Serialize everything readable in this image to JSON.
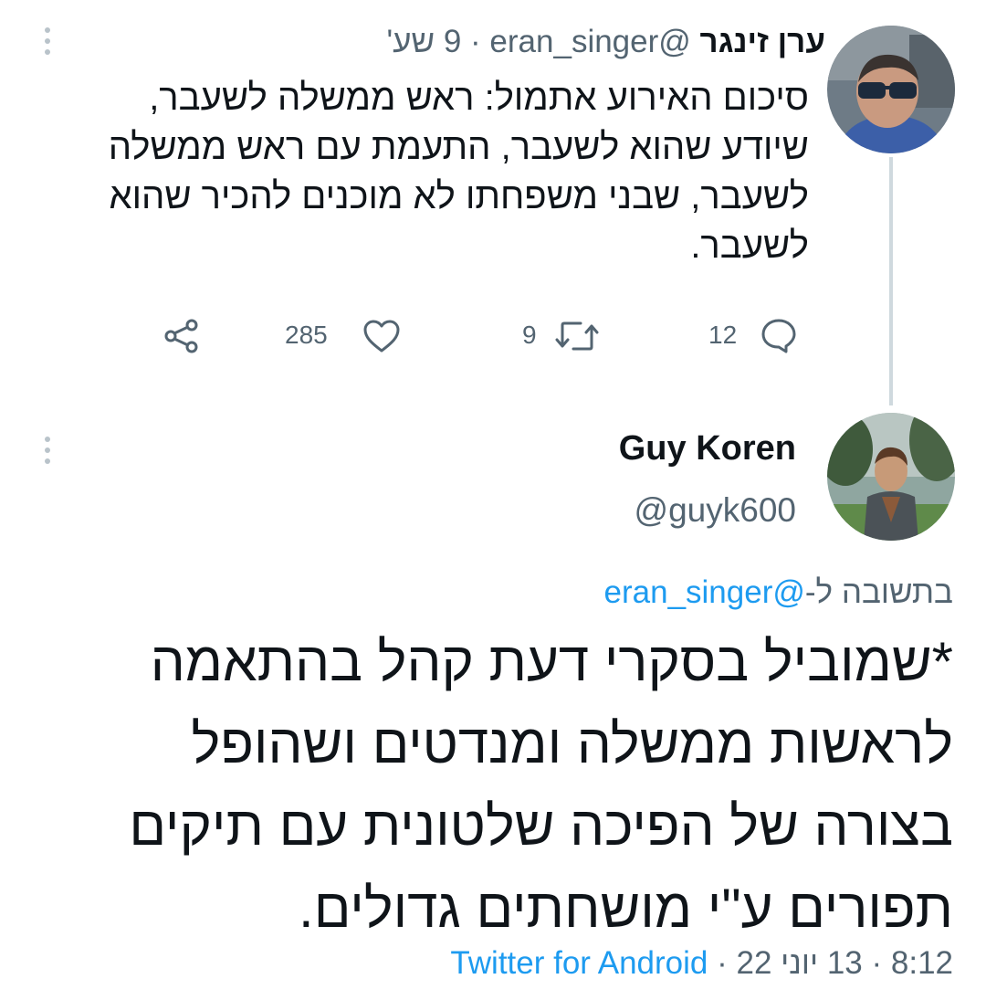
{
  "original_tweet": {
    "author_name": "ערן זינגר",
    "handle": "@eran_singer",
    "separator": "·",
    "time_ago": "9 שע'",
    "text": "סיכום האירוע אתמול: ראש ממשלה לשעבר, שיודע שהוא לשעבר, התעמת עם ראש ממשלה לשעבר, שבני משפחתו לא מוכנים להכיר שהוא לשעבר.",
    "actions": {
      "reply_count": "12",
      "retweet_count": "9",
      "like_count": "285"
    }
  },
  "reply_tweet": {
    "author_name": "Guy Koren",
    "handle": "@guyk600",
    "replying_to_label": "בתשובה ל-",
    "replying_to_handle": "@eran_singer",
    "text": "*שמוביל בסקרי דעת קהל בהתאמה לראשות ממשלה ומנדטים ושהופל בצורה של הפיכה שלטונית עם תיקים תפורים ע\"י מושחתים גדולים.",
    "time": "8:12",
    "date": "13 יוני 22",
    "separator": "·",
    "source": "Twitter for Android"
  },
  "icons": {
    "reply": "comment-icon",
    "retweet": "retweet-icon",
    "like": "heart-icon",
    "share": "share-icon",
    "more": "more-vertical-icon"
  },
  "colors": {
    "link": "#1d9bf0",
    "secondary_text": "#536471",
    "thread_line": "#cfd9de"
  }
}
